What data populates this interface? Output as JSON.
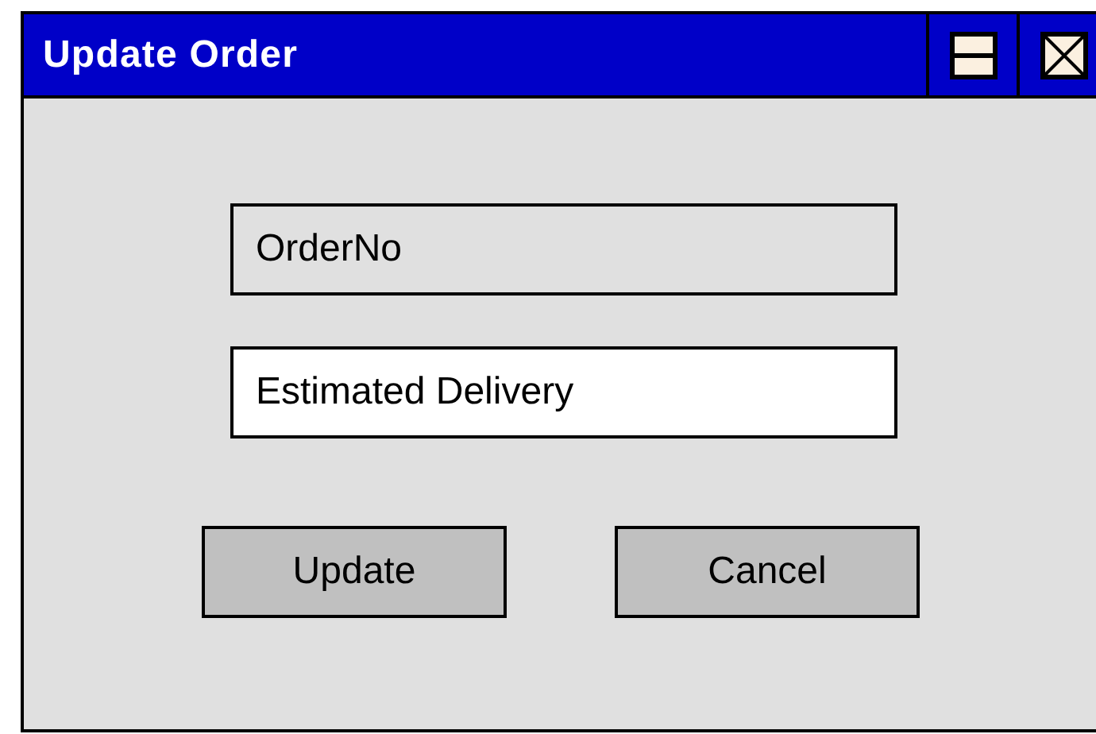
{
  "window": {
    "title": "Update Order"
  },
  "fields": [
    {
      "value": "OrderNo",
      "disabled": true
    },
    {
      "value": "Estimated Delivery",
      "disabled": false
    }
  ],
  "buttons": [
    "Update",
    "Cancel"
  ]
}
